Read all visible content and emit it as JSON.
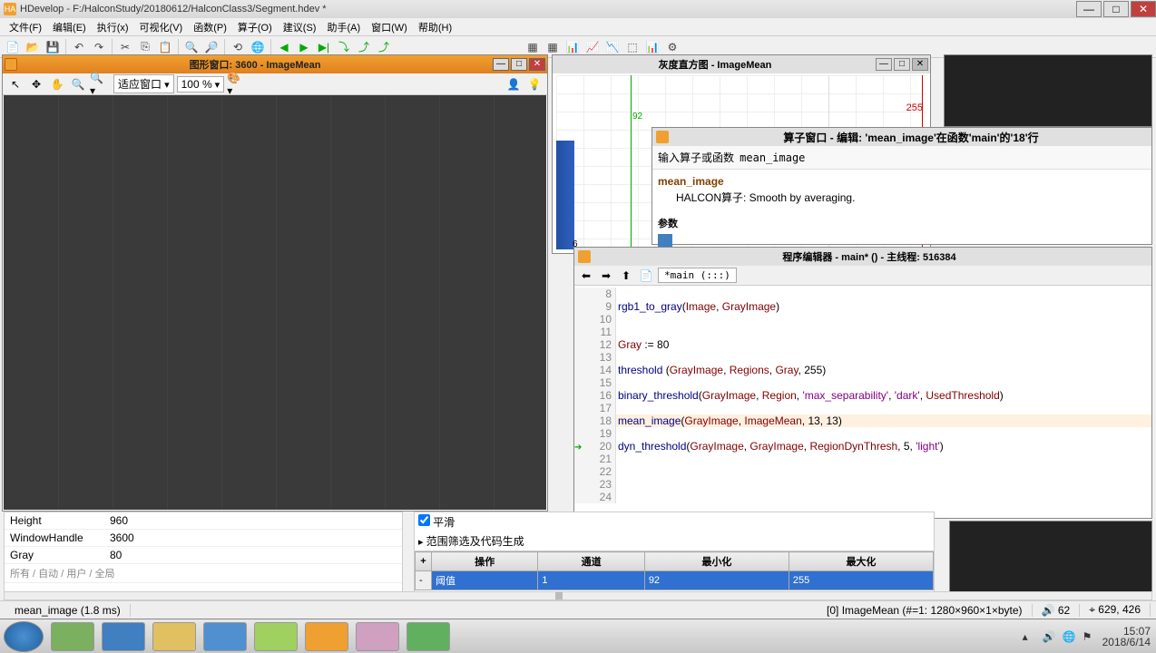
{
  "titlebar": {
    "title": "HDevelop - F:/HalconStudy/20180612/HalconClass3/Segment.hdev *"
  },
  "menus": [
    "文件(F)",
    "编辑(E)",
    "执行(x)",
    "可视化(V)",
    "函数(P)",
    "算子(O)",
    "建议(S)",
    "助手(A)",
    "窗口(W)",
    "帮助(H)"
  ],
  "graphicsWindow": {
    "title": "图形窗口: 3600 - ImageMean",
    "fit": "适应窗口",
    "zoom": "100 %"
  },
  "histogram": {
    "title": "灰度直方图 - ImageMean",
    "marker": "92",
    "max": "255",
    "tick": "6"
  },
  "operatorWindow": {
    "title": "算子窗口 - 编辑:  'mean_image'在函数'main'的'18'行",
    "inputLabel": "输入算子或函数",
    "inputValue": "mean_image",
    "opName": "mean_image",
    "opDesc": "HALCON算子:  Smooth by averaging.",
    "paramHeader": "参数"
  },
  "programEditor": {
    "title": "程序编辑器 - main* () - 主线程: 516384",
    "tab": "*main (:::)",
    "lines": [
      {
        "n": "8",
        "t": ""
      },
      {
        "n": "9",
        "t": "rgb1_to_gray(Image, GrayImage)"
      },
      {
        "n": "10",
        "t": ""
      },
      {
        "n": "11",
        "t": ""
      },
      {
        "n": "12",
        "t": "Gray := 80"
      },
      {
        "n": "13",
        "t": ""
      },
      {
        "n": "14",
        "t": "threshold (GrayImage, Regions, Gray, 255)"
      },
      {
        "n": "15",
        "t": ""
      },
      {
        "n": "16",
        "t": "binary_threshold(GrayImage, Region, 'max_separability', 'dark', UsedThreshold)"
      },
      {
        "n": "17",
        "t": ""
      },
      {
        "n": "18",
        "t": "mean_image(GrayImage, ImageMean, 13, 13)",
        "hl": true
      },
      {
        "n": "19",
        "t": ""
      },
      {
        "n": "20",
        "t": "dyn_threshold(GrayImage, GrayImage, RegionDynThresh, 5, 'light')",
        "arrow": true
      },
      {
        "n": "21",
        "t": ""
      },
      {
        "n": "22",
        "t": ""
      },
      {
        "n": "23",
        "t": ""
      },
      {
        "n": "24",
        "t": ""
      }
    ]
  },
  "vars": [
    {
      "name": "Height",
      "val": "960"
    },
    {
      "name": "WindowHandle",
      "val": "3600"
    },
    {
      "name": "Gray",
      "val": "80"
    }
  ],
  "varFooter": "所有 / 自动 / 用户 / 全局",
  "rangePanel": {
    "chk": "平滑",
    "hdr": "范围筛选及代码生成",
    "cols": [
      "操作",
      "通道",
      "最小化",
      "最大化"
    ],
    "row": [
      "阈值",
      "1",
      "92",
      "255"
    ],
    "plus": "+",
    "minus": "-"
  },
  "status": {
    "left": "mean_image (1.8 ms)",
    "mid": "[0] ImageMean (#=1: 1280×960×1×byte)",
    "pct": "62",
    "coords": "629, 426"
  },
  "clock": {
    "time": "15:07",
    "date": "2018/6/14"
  }
}
